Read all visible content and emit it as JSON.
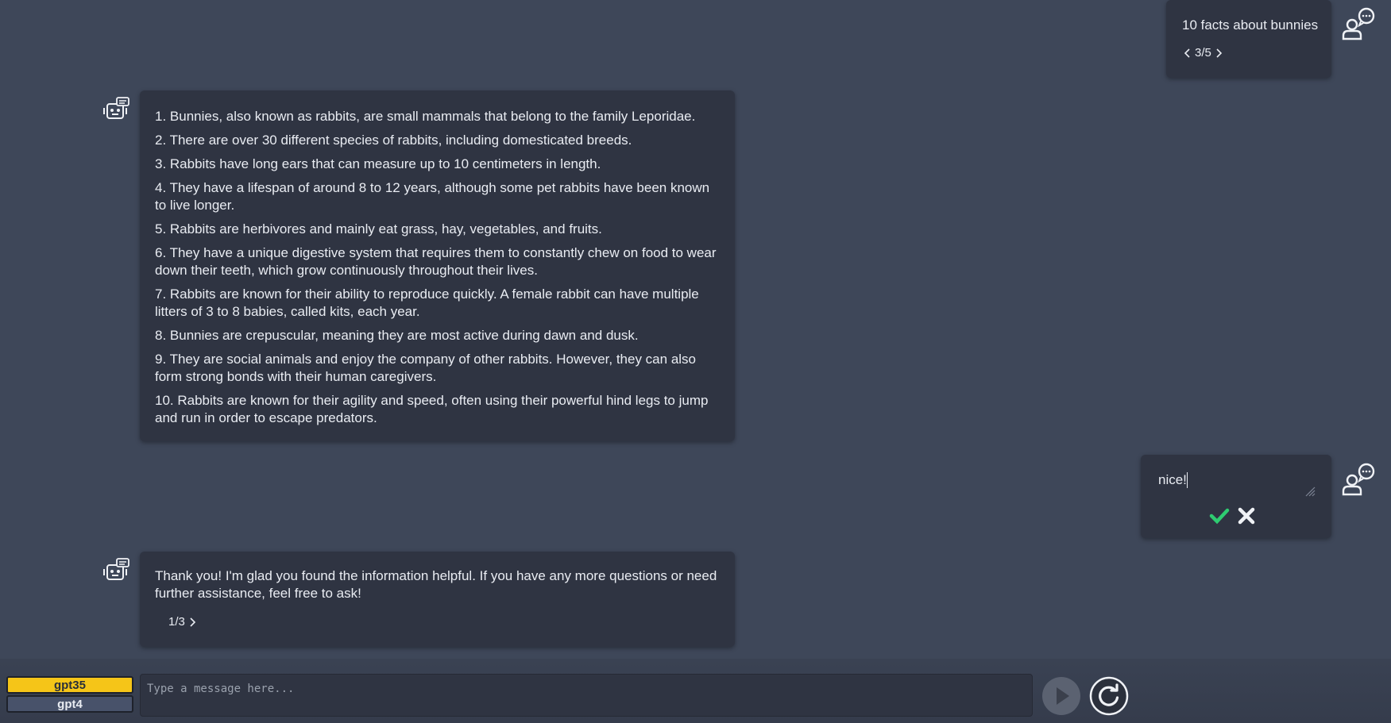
{
  "conversation": {
    "user_message_1": {
      "text": "10 facts about bunnies",
      "pager": "3/5"
    },
    "bot_message_1": {
      "lines": [
        "1. Bunnies, also known as rabbits, are small mammals that belong to the family Leporidae.",
        "2. There are over 30 different species of rabbits, including domesticated breeds.",
        "3. Rabbits have long ears that can measure up to 10 centimeters in length.",
        "4. They have a lifespan of around 8 to 12 years, although some pet rabbits have been known to live longer.",
        "5. Rabbits are herbivores and mainly eat grass, hay, vegetables, and fruits.",
        "6. They have a unique digestive system that requires them to constantly chew on food to wear down their teeth, which grow continuously throughout their lives.",
        "7. Rabbits are known for their ability to reproduce quickly. A female rabbit can have multiple litters of 3 to 8 babies, called kits, each year.",
        "8. Bunnies are crepuscular, meaning they are most active during dawn and dusk.",
        "9. They are social animals and enjoy the company of other rabbits. However, they can also form strong bonds with their human caregivers.",
        "10. Rabbits are known for their agility and speed, often using their powerful hind legs to jump and run in order to escape predators."
      ]
    },
    "user_message_2": {
      "edit_value": "nice!"
    },
    "bot_message_2": {
      "text": "Thank you! I'm glad you found the information helpful. If you have any more questions or need further assistance, feel free to ask!",
      "pager": "1/3"
    }
  },
  "footer": {
    "models": [
      "gpt35",
      "gpt4"
    ],
    "active_model": "gpt35",
    "input_placeholder": "Type a message here..."
  },
  "icons": {
    "user": "user-chat-icon",
    "bot": "robot-icon",
    "confirm": "check-icon",
    "cancel": "close-icon",
    "send": "play-icon",
    "refresh": "refresh-icon"
  },
  "colors": {
    "background": "#3e4759",
    "bubble": "#2f3442",
    "active_model": "#f5c518",
    "confirm": "#2ecc71"
  }
}
